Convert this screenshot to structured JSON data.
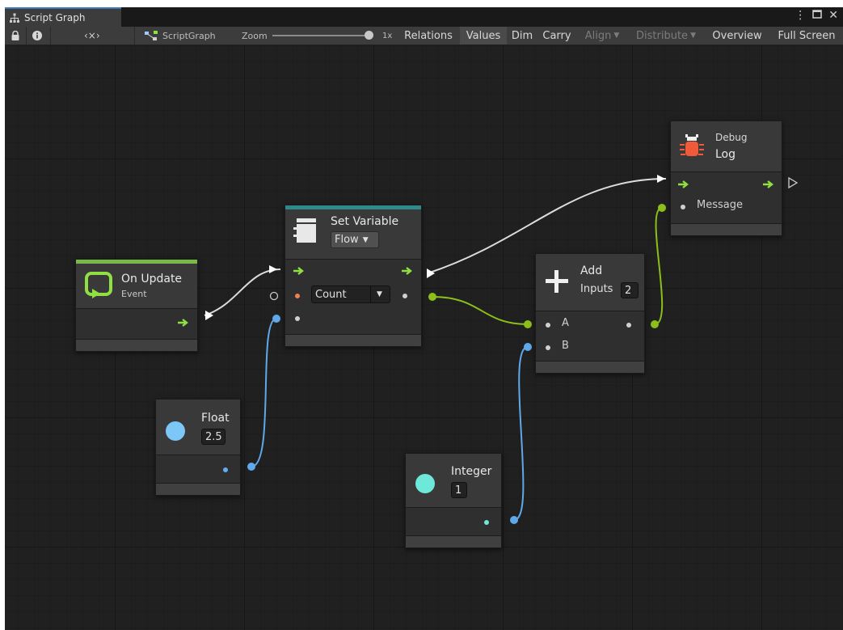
{
  "tab": {
    "title": "Script Graph"
  },
  "toolbar": {
    "breadcrumb": "ScriptGraph",
    "zoom_label": "Zoom",
    "zoom_value": "1x",
    "zoom_level": 1.0,
    "relations": "Relations",
    "values": "Values",
    "dim": "Dim",
    "carry": "Carry",
    "align": "Align",
    "distribute": "Distribute",
    "overview": "Overview",
    "fullscreen": "Full Screen"
  },
  "nodes": {
    "on_update": {
      "title": "On Update",
      "subtitle": "Event"
    },
    "set_variable": {
      "title": "Set Variable",
      "kind": "Flow",
      "variable": "Count"
    },
    "float": {
      "title": "Float",
      "value": "2.5"
    },
    "integer": {
      "title": "Integer",
      "value": "1"
    },
    "add": {
      "title": "Add",
      "inputs_label": "Inputs",
      "inputs_count": "2",
      "port_a": "A",
      "port_b": "B"
    },
    "debug_log": {
      "category": "Debug",
      "title": "Log",
      "port_message": "Message"
    }
  },
  "colors": {
    "flow_arrow": "#8ee043",
    "float_port": "#64aef0",
    "float_icon": "#7cc6f8",
    "integer_icon": "#6ee8d8",
    "object_wire": "#8cbf1a",
    "event_stripe": "#79b94a",
    "variable_stripe": "#2e8a8a",
    "debug_icon": "#f05a3a"
  },
  "icons": [
    "lock-icon",
    "info-icon",
    "variables-icon",
    "graph-icon",
    "window-menu-icon",
    "maximize-icon",
    "close-icon",
    "loop-event-icon",
    "set-variable-icon",
    "plus-icon",
    "bug-icon",
    "dropdown-arrow-icon"
  ]
}
